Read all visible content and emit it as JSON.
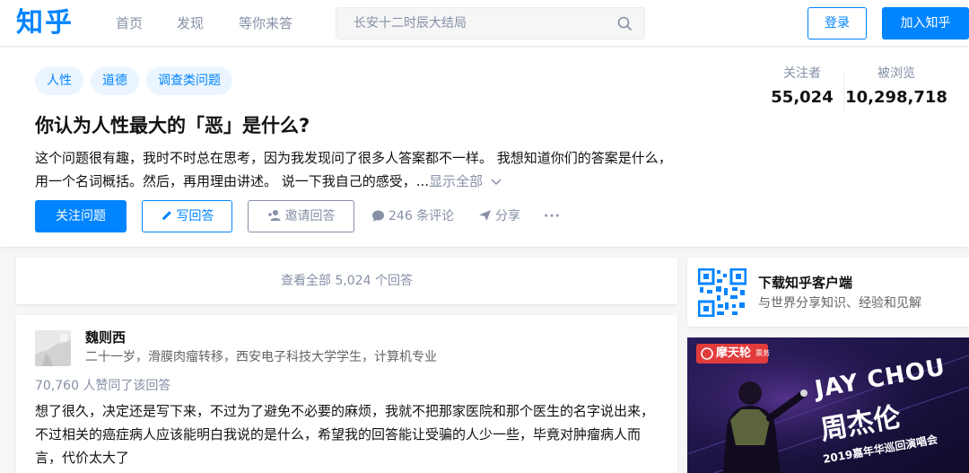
{
  "header": {
    "logo": "知乎",
    "nav": [
      "首页",
      "发现",
      "等你来答"
    ],
    "search_placeholder": "长安十二时辰大结局",
    "login_label": "登录",
    "join_label": "加入知乎"
  },
  "question": {
    "tags": [
      "人性",
      "道德",
      "调查类问题"
    ],
    "title": "你认为人性最大的「恶」是什么?",
    "description": "这个问题很有趣，我时不时总在思考，因为我发现问了很多人答案都不一样。 我想知道你们的答案是什么，用一个名词概括。然后，再用理由讲述。 说一下我自己的感受，...",
    "show_all": "显示全部",
    "stats": {
      "followers_label": "关注者",
      "followers_value": "55,024",
      "views_label": "被浏览",
      "views_value": "10,298,718"
    },
    "actions": {
      "follow": "关注问题",
      "write": "写回答",
      "invite": "邀请回答",
      "comments": "246 条评论",
      "share": "分享",
      "more": "···"
    }
  },
  "main": {
    "view_all": "查看全部 5,024 个回答",
    "answer": {
      "author_name": "魏则西",
      "author_bio": "二十一岁，滑膜肉瘤转移，西安电子科技大学学生，计算机专业",
      "votes": "70,760 人赞同了该回答",
      "content": "想了很久，决定还是写下来，不过为了避免不必要的麻烦，我就不把那家医院和那个医生的名字说出来，不过相关的癌症病人应该能明白我说的是什么，希望我的回答能让受骗的人少一些，毕竟对肿瘤病人而言，代价太大了"
    }
  },
  "sidebar": {
    "app_title": "下载知乎客户端",
    "app_subtitle": "与世界分享知识、经验和见解",
    "ad": {
      "brand": "摩天轮",
      "brand_sub": "票务",
      "headline_en": "JAY CHOU",
      "headline_cn": "周杰伦",
      "tagline": "2019嘉年华巡回演唱会"
    }
  },
  "colors": {
    "brand_blue": "#0084ff",
    "tag_bg": "#ebf5ff",
    "muted": "#8590a6"
  }
}
